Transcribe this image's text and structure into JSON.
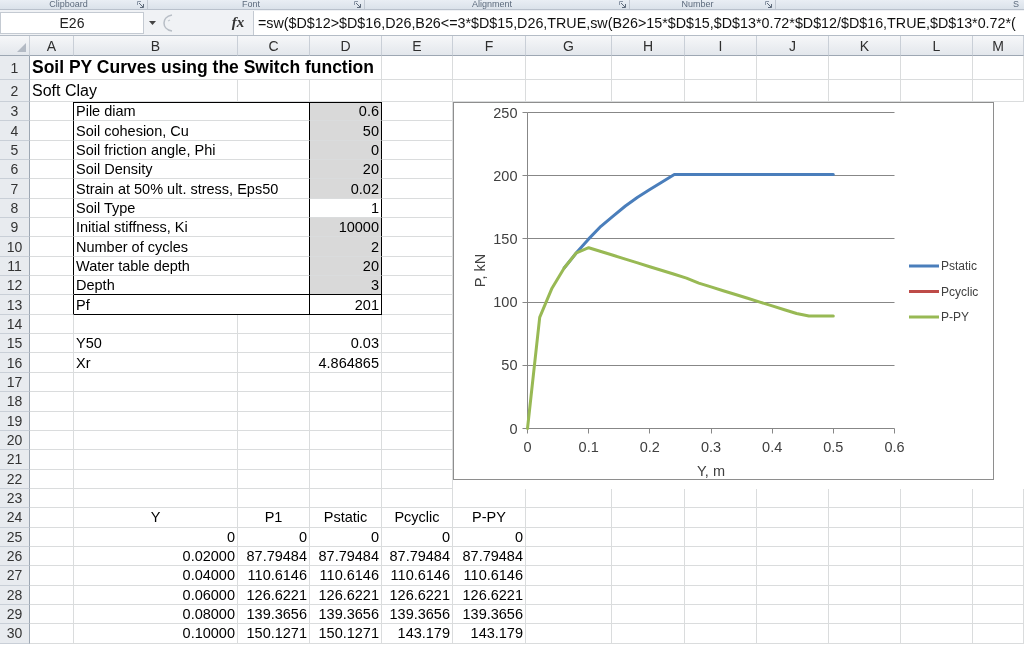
{
  "ribbon_groups": [
    {
      "label": "Clipboard",
      "launcher": true
    },
    {
      "label": "Font",
      "launcher": true
    },
    {
      "label": "Alignment",
      "launcher": true
    },
    {
      "label": "Number",
      "launcher": true
    },
    {
      "label": "S",
      "launcher": false
    }
  ],
  "formula_bar": {
    "name_box": "E26",
    "function_button": "fx",
    "formula": "=sw($D$12>$D$16,D26,B26<=3*$D$15,D26,TRUE,sw(B26>15*$D$15,$D$13*0.72*$D$12/$D$16,TRUE,$D$13*0.72*("
  },
  "column_headers": [
    "A",
    "B",
    "C",
    "D",
    "E",
    "F",
    "G",
    "H",
    "I",
    "J",
    "K",
    "L",
    "M"
  ],
  "row_headers": [
    "1",
    "2",
    "3",
    "4",
    "5",
    "6",
    "7",
    "8",
    "9",
    "10",
    "11",
    "12",
    "13",
    "14",
    "15",
    "16",
    "17",
    "18",
    "19",
    "20",
    "21",
    "22",
    "23",
    "24",
    "25",
    "26",
    "27",
    "28",
    "29",
    "30"
  ],
  "sheet": {
    "title": "Soil PY Curves using the Switch function",
    "subtitle": "Soft Clay",
    "parameters": [
      {
        "label": "Pile diam",
        "value": "0.6",
        "shaded": true
      },
      {
        "label": "Soil cohesion, Cu",
        "value": "50",
        "shaded": true
      },
      {
        "label": "Soil friction angle, Phi",
        "value": "0",
        "shaded": true
      },
      {
        "label": "Soil Density",
        "value": "20",
        "shaded": true
      },
      {
        "label": "Strain at 50% ult. stress, Eps50",
        "value": "0.02",
        "shaded": true
      },
      {
        "label": "Soil Type",
        "value": "1",
        "shaded": false
      },
      {
        "label": "Initial stiffness, Ki",
        "value": "10000",
        "shaded": true
      },
      {
        "label": "Number of cycles",
        "value": "2",
        "shaded": true
      },
      {
        "label": "Water table depth",
        "value": "20",
        "shaded": true
      },
      {
        "label": "Depth",
        "value": "3",
        "shaded": true
      }
    ],
    "result": {
      "label": "Pf",
      "value": "201"
    },
    "derived": [
      {
        "label": "Y50",
        "value": "0.03"
      },
      {
        "label": "Xr",
        "value": "4.864865"
      }
    ],
    "table": {
      "columns": [
        "Y",
        "P1",
        "Pstatic",
        "Pcyclic",
        "P-PY"
      ],
      "rows": [
        [
          "0",
          "0",
          "0",
          "0",
          "0"
        ],
        [
          "0.02000",
          "87.79484",
          "87.79484",
          "87.79484",
          "87.79484"
        ],
        [
          "0.04000",
          "110.6146",
          "110.6146",
          "110.6146",
          "110.6146"
        ],
        [
          "0.06000",
          "126.6221",
          "126.6221",
          "126.6221",
          "126.6221"
        ],
        [
          "0.08000",
          "139.3656",
          "139.3656",
          "139.3656",
          "139.3656"
        ],
        [
          "0.10000",
          "150.1271",
          "150.1271",
          "143.179",
          "143.179"
        ]
      ]
    }
  },
  "chart": {
    "chart_data": {
      "type": "line",
      "xlabel": "Y, m",
      "ylabel": "P, kN",
      "x": [
        0,
        0.02,
        0.04,
        0.06,
        0.08,
        0.1,
        0.12,
        0.14,
        0.16,
        0.18,
        0.2,
        0.22,
        0.24,
        0.26,
        0.28,
        0.3,
        0.32,
        0.34,
        0.36,
        0.38,
        0.4,
        0.42,
        0.44,
        0.46,
        0.48,
        0.5
      ],
      "series": [
        {
          "name": "Pstatic",
          "color": "#4a7ebb",
          "values": [
            null,
            null,
            null,
            127,
            139,
            150,
            160,
            168,
            176,
            183,
            189,
            195,
            201,
            201,
            201,
            201,
            201,
            201,
            201,
            201,
            201,
            201,
            201,
            201,
            201,
            201
          ]
        },
        {
          "name": "Pcyclic",
          "color": "#be4b48",
          "values": [
            null,
            null,
            null,
            null,
            null,
            null,
            null,
            null,
            null,
            null,
            null,
            null,
            null,
            null,
            null,
            null,
            null,
            null,
            null,
            null,
            null,
            null,
            null,
            null,
            null,
            null
          ]
        },
        {
          "name": "P-PY",
          "color": "#98b954",
          "values": [
            0,
            88,
            111,
            127,
            139,
            143,
            140,
            137,
            134,
            131,
            128,
            125,
            122,
            119,
            115,
            112,
            109,
            106,
            103,
            100,
            97,
            94,
            91,
            89,
            89,
            89
          ]
        }
      ],
      "xlim": [
        0,
        0.6
      ],
      "ylim": [
        0,
        250
      ],
      "xticks": [
        {
          "value": 0,
          "label": "0"
        },
        {
          "value": 0.1,
          "label": "0.1"
        },
        {
          "value": 0.2,
          "label": "0.2"
        },
        {
          "value": 0.3,
          "label": "0.3"
        },
        {
          "value": 0.4,
          "label": "0.4"
        },
        {
          "value": 0.5,
          "label": "0.5"
        },
        {
          "value": 0.6,
          "label": "0.6"
        }
      ],
      "yticks": [
        {
          "value": 0,
          "label": "0"
        },
        {
          "value": 50,
          "label": "50"
        },
        {
          "value": 100,
          "label": "100"
        },
        {
          "value": 150,
          "label": "150"
        },
        {
          "value": 200,
          "label": "200"
        },
        {
          "value": 250,
          "label": "250"
        }
      ],
      "grid": true,
      "legend": true
    }
  }
}
